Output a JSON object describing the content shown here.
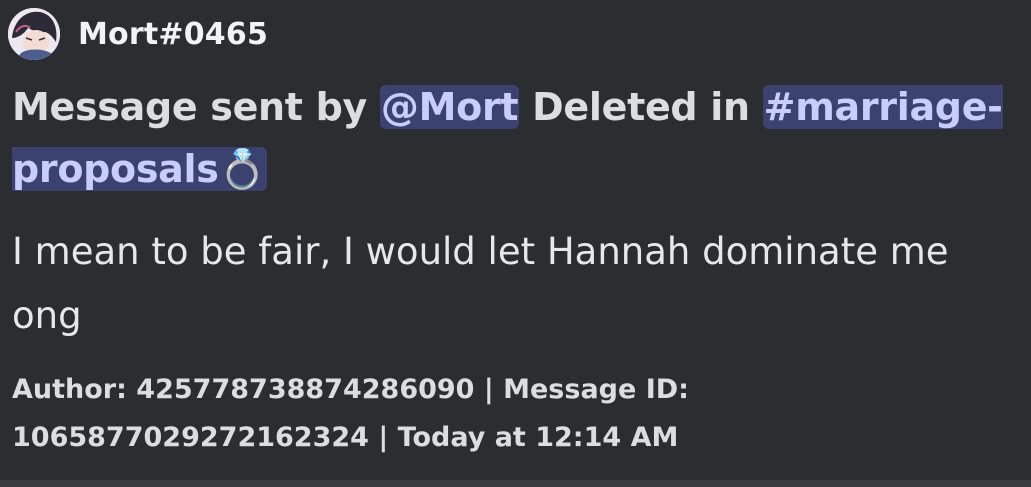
{
  "author": {
    "name": "Mort#0465"
  },
  "title": {
    "prefix": "Message sent by ",
    "user_mention": "@Mort",
    "middle": " Deleted in ",
    "channel_mention": "#marriage-proposals",
    "channel_emoji": "💍"
  },
  "message": {
    "content": "I mean to be fair, I would let Hannah dominate me ong"
  },
  "footer": {
    "text": "Author: 425778738874286090 | Message ID: 1065877029272162324 | Today at 12:14 AM"
  },
  "colors": {
    "background": "#2b2d31",
    "mention_bg": "#3c4270",
    "mention_text": "#c9cdfb"
  }
}
